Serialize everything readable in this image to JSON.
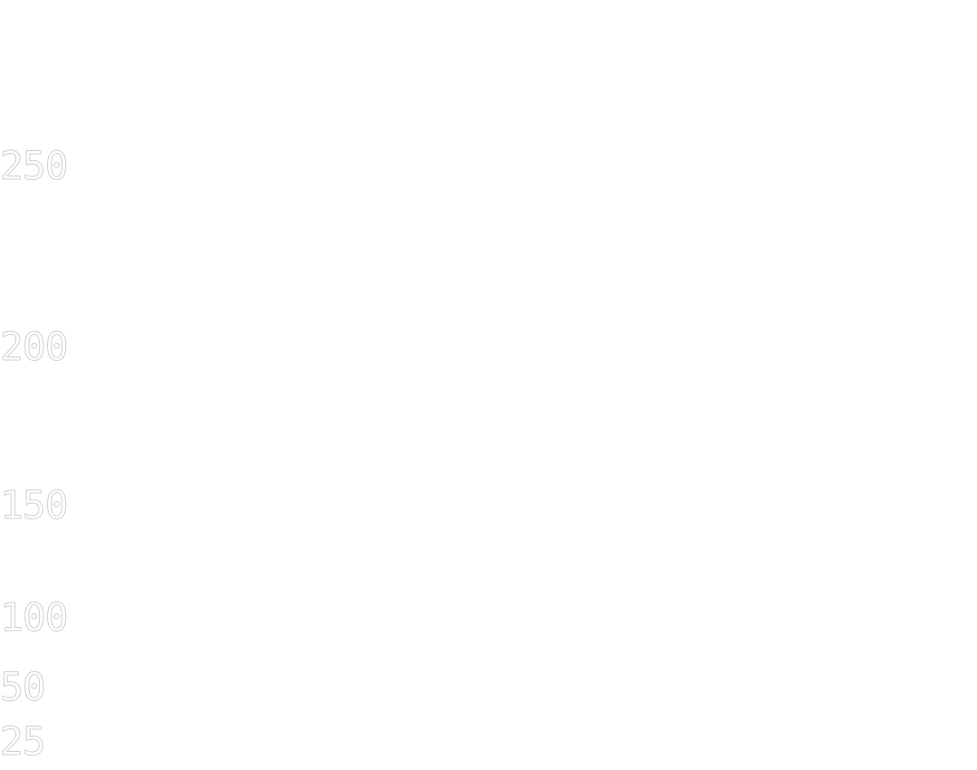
{
  "scale_labels": {
    "v250": "250",
    "v200": "200",
    "v150": "150",
    "v100": "100",
    "v50": "50",
    "v25": "25"
  },
  "colors": {
    "background": "#ffffff",
    "label_outline": "#cfcfcf"
  }
}
